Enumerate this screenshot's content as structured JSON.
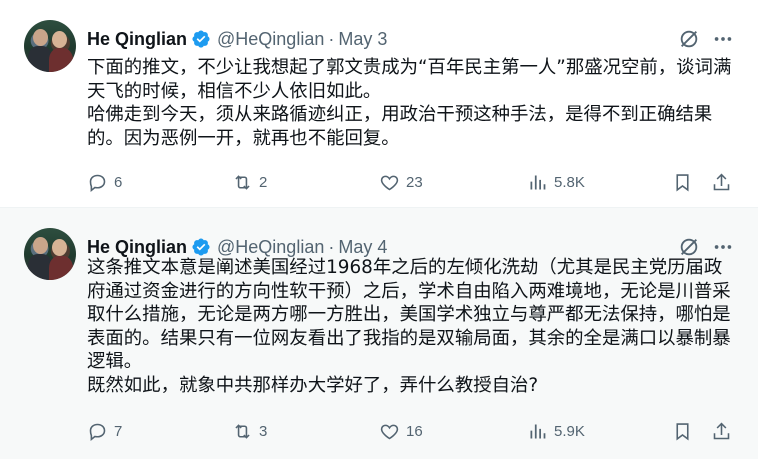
{
  "colors": {
    "text": "#0f1419",
    "secondary": "#536471",
    "verified": "#1d9bf0",
    "divider": "#eff3f4",
    "highlight_bg": "#f7f9f9"
  },
  "tweets": [
    {
      "author_name": "He Qinglian",
      "handle": "@HeQinglian",
      "separator": "·",
      "date": "May 3",
      "lines": [
        "下面的推文，不少让我想起了郭文贵成为“百年民主第一人”那盛况空前，谈词满天飞的时候，相信不少人依旧如此。",
        "哈佛走到今天，须从来路循迹纠正，用政治干预这种手法，是得不到正确结果的。因为恶例一开，就再也不能回复。"
      ],
      "replies": "6",
      "reposts": "2",
      "likes": "23",
      "views": "5.8K",
      "icons": {
        "reply": "reply-icon",
        "repost": "repost-icon",
        "like": "heart-icon",
        "views": "views-icon",
        "bookmark": "bookmark-icon",
        "share": "share-icon",
        "grok": "grok-icon",
        "more": "more-icon"
      }
    },
    {
      "author_name": "He Qinglian",
      "handle": "@HeQinglian",
      "separator": "·",
      "date": "May 4",
      "lines": [
        "这条推文本意是阐述美国经过1968年之后的左倾化洗劫（尤其是民主党历届政府通过资金进行的方向性软干预）之后，学术自由陷入两难境地，无论是川普采取什么措施，无论是两方哪一方胜出，美国学术独立与尊严都无法保持，哪怕是表面的。结果只有一位网友看出了我指的是双输局面，其余的全是满口以暴制暴逻辑。",
        "既然如此，就象中共那样办大学好了，弄什么教授自治?"
      ],
      "replies": "7",
      "reposts": "3",
      "likes": "16",
      "views": "5.9K",
      "icons": {
        "reply": "reply-icon",
        "repost": "repost-icon",
        "like": "heart-icon",
        "views": "views-icon",
        "bookmark": "bookmark-icon",
        "share": "share-icon",
        "grok": "grok-icon",
        "more": "more-icon"
      }
    }
  ]
}
